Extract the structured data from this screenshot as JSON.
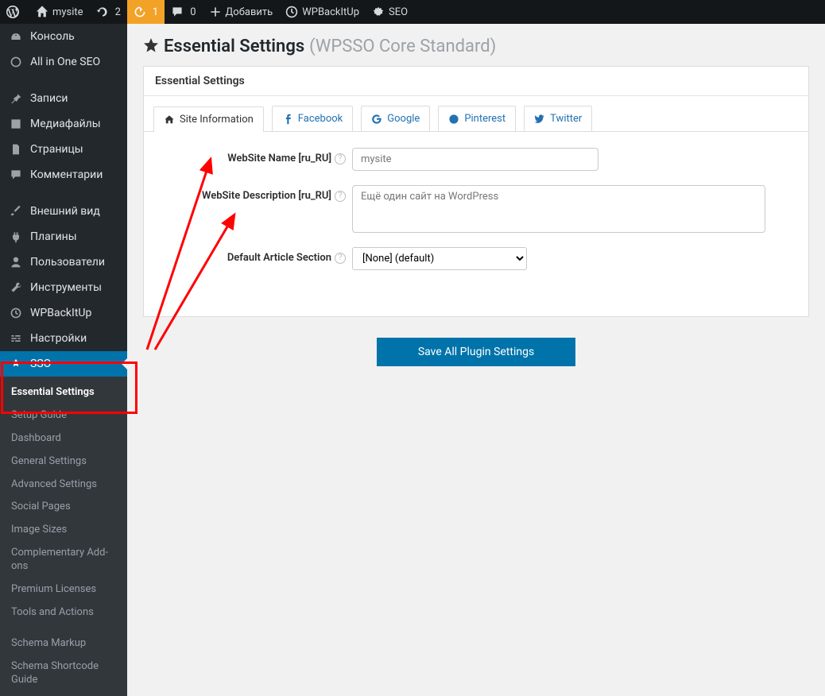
{
  "adminbar": {
    "site": "mysite",
    "refresh_count": "2",
    "updates_count": "1",
    "comments_count": "0",
    "add_label": "Добавить",
    "wpbackitup": "WPBackItUp",
    "seo": "SEO"
  },
  "sidebar": {
    "items": [
      {
        "label": "Консоль"
      },
      {
        "label": "All in One SEO"
      },
      {
        "label": "Записи"
      },
      {
        "label": "Медиафайлы"
      },
      {
        "label": "Страницы"
      },
      {
        "label": "Комментарии"
      },
      {
        "label": "Внешний вид"
      },
      {
        "label": "Плагины"
      },
      {
        "label": "Пользователи"
      },
      {
        "label": "Инструменты"
      },
      {
        "label": "WPBackItUp"
      },
      {
        "label": "Настройки"
      },
      {
        "label": "SSO"
      }
    ],
    "submenu": [
      {
        "label": "Essential Settings",
        "current": true
      },
      {
        "label": "Setup Guide"
      },
      {
        "label": "Dashboard"
      },
      {
        "label": "General Settings"
      },
      {
        "label": "Advanced Settings"
      },
      {
        "label": "Social Pages"
      },
      {
        "label": "Image Sizes"
      },
      {
        "label": "Complementary Add-ons"
      },
      {
        "label": "Premium Licenses"
      },
      {
        "label": "Tools and Actions"
      },
      {
        "label": "Schema Markup"
      },
      {
        "label": "Schema Shortcode Guide"
      }
    ]
  },
  "page": {
    "title": "Essential Settings",
    "subtitle": "(WPSSO Core Standard)",
    "box_title": "Essential Settings"
  },
  "tabs": [
    {
      "label": "Site Information"
    },
    {
      "label": "Facebook"
    },
    {
      "label": "Google"
    },
    {
      "label": "Pinterest"
    },
    {
      "label": "Twitter"
    }
  ],
  "form": {
    "name_label": "WebSite Name [ru_RU]",
    "name_value": "mysite",
    "desc_label": "WebSite Description [ru_RU]",
    "desc_value": "Ещё один сайт на WordPress",
    "section_label": "Default Article Section",
    "section_value": "[None] (default)"
  },
  "buttons": {
    "save": "Save All Plugin Settings"
  }
}
